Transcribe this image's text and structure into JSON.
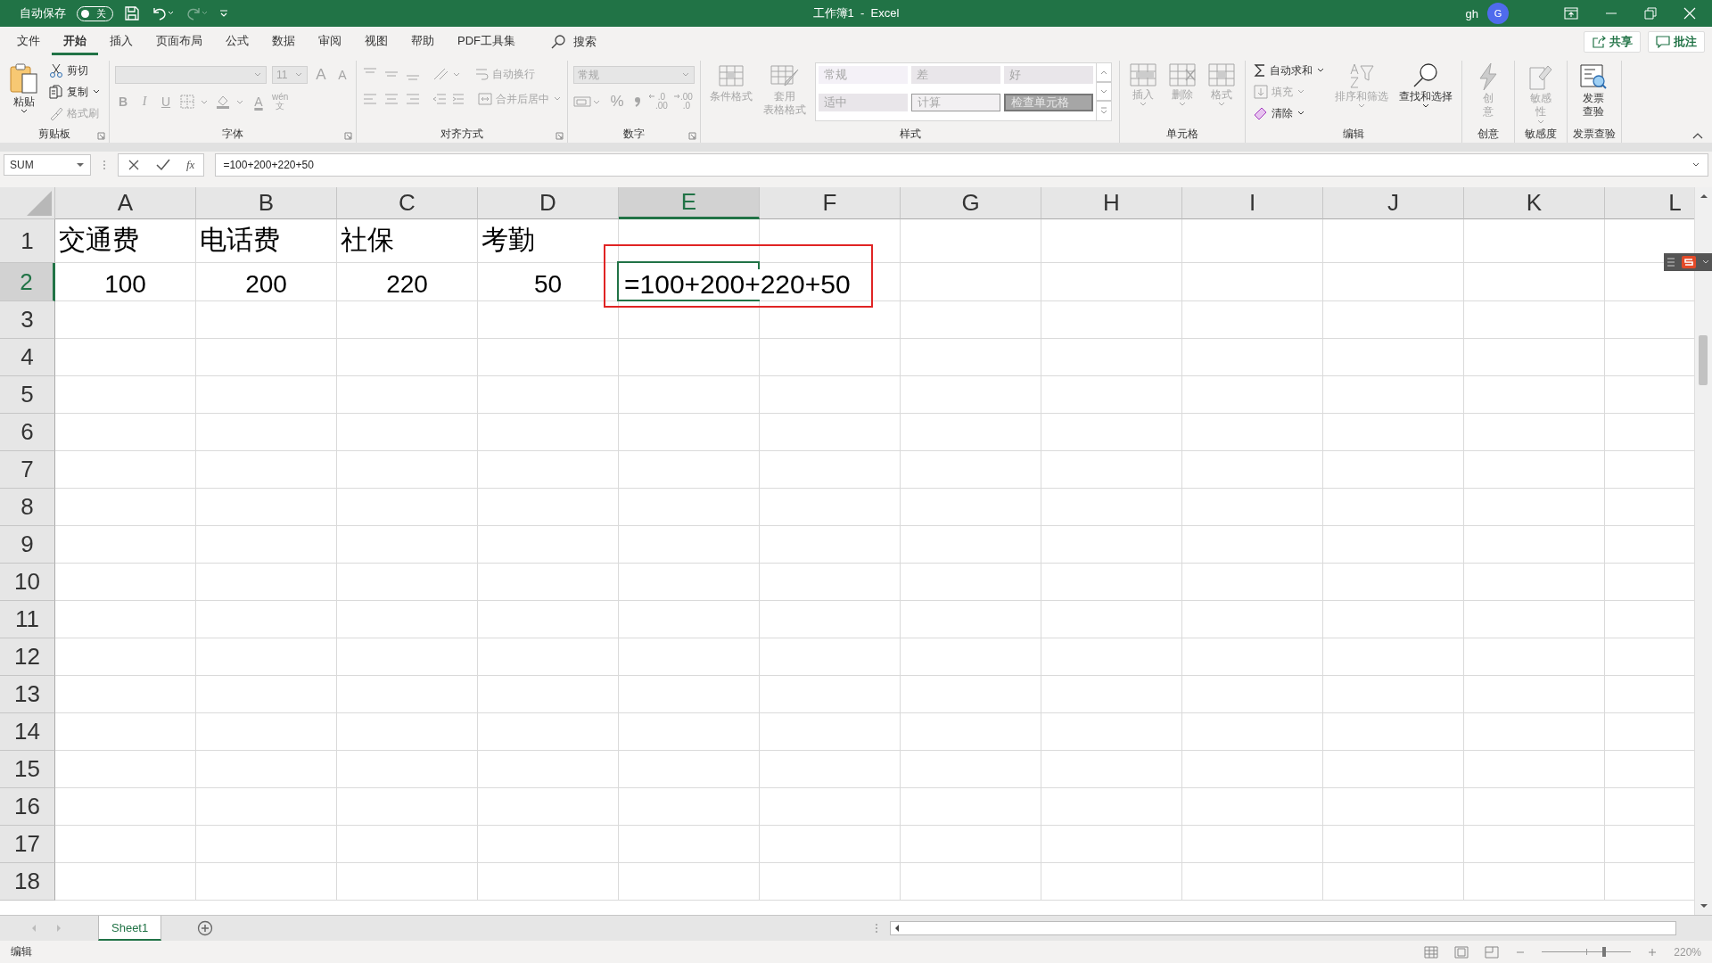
{
  "title_bar": {
    "autosave_label": "自动保存",
    "autosave": {
      "on": false,
      "label": "关"
    },
    "redo_disabled": true,
    "title": "工作簿1  -  Excel",
    "user": "gh",
    "avatar": "G"
  },
  "tabs": [
    {
      "label": "文件",
      "selected": false
    },
    {
      "label": "开始",
      "selected": true
    },
    {
      "label": "插入",
      "selected": false
    },
    {
      "label": "页面布局",
      "selected": false
    },
    {
      "label": "公式",
      "selected": false
    },
    {
      "label": "数据",
      "selected": false
    },
    {
      "label": "审阅",
      "selected": false
    },
    {
      "label": "视图",
      "selected": false
    },
    {
      "label": "帮助",
      "selected": false
    },
    {
      "label": "PDF工具集",
      "selected": false
    }
  ],
  "search": {
    "label": "搜索"
  },
  "actions": [
    {
      "kind": "share",
      "label": "共享"
    },
    {
      "kind": "comment",
      "label": "批注"
    }
  ],
  "ribbon": [
    {
      "kind": "clipboard",
      "label": "剪贴板",
      "paste": {
        "label": "粘贴",
        "disabled": false
      },
      "items": [
        {
          "kind": "cut",
          "label": "剪切",
          "disabled": false
        },
        {
          "kind": "copy",
          "label": "复制",
          "disabled": false
        },
        {
          "kind": "painter",
          "label": "格式刷",
          "disabled": true
        }
      ]
    },
    {
      "kind": "font",
      "label": "字体",
      "disabled": true,
      "size": "11",
      "grow": "A",
      "shrink": "A",
      "styles": [
        "B",
        "I",
        "U"
      ],
      "color_letter": "A",
      "phonetic_top": "wén",
      "phonetic_bottom": "文"
    },
    {
      "kind": "alignment",
      "label": "对齐方式",
      "disabled": true,
      "wrap": "自动换行",
      "merge": "合并后居中"
    },
    {
      "kind": "number",
      "label": "数字",
      "disabled": true,
      "format": "常规",
      "percent": "%",
      "decimals": [
        {
          "top": ".0",
          "bottom": ".00"
        },
        {
          "top": ".00",
          "bottom": ".0"
        }
      ]
    },
    {
      "kind": "styles",
      "label": "样式",
      "buttons": [
        {
          "kind": "conditional",
          "lines": [
            "条件格式"
          ],
          "disabled": true
        },
        {
          "kind": "table",
          "lines": [
            "套用",
            "表格格式"
          ],
          "disabled": true
        }
      ],
      "gallery": [
        {
          "kind": "normal",
          "label": "常规"
        },
        {
          "kind": "bad",
          "label": "差"
        },
        {
          "kind": "good",
          "label": "好"
        },
        {
          "kind": "neutral",
          "label": "适中"
        },
        {
          "kind": "calc",
          "label": "计算"
        },
        {
          "kind": "check",
          "label": "检查单元格"
        }
      ]
    },
    {
      "kind": "cells",
      "label": "单元格",
      "buttons": [
        {
          "kind": "insert",
          "label": "插入",
          "disabled": true
        },
        {
          "kind": "delete",
          "label": "删除",
          "disabled": true
        },
        {
          "kind": "format",
          "label": "格式",
          "disabled": true
        }
      ]
    },
    {
      "kind": "editing",
      "label": "编辑",
      "items": [
        {
          "kind": "sum",
          "label": "自动求和",
          "disabled": false
        },
        {
          "kind": "fill",
          "label": "填充",
          "disabled": true
        },
        {
          "kind": "clear",
          "label": "清除",
          "disabled": false
        }
      ],
      "buttons": [
        {
          "kind": "sort",
          "label": "排序和筛选",
          "disabled": true
        },
        {
          "kind": "find",
          "label": "查找和选择",
          "disabled": false
        }
      ]
    },
    {
      "kind": "single",
      "label": "创意",
      "button": {
        "kind": "bolt",
        "lines": [
          "创",
          "意"
        ],
        "disabled": true
      }
    },
    {
      "kind": "single",
      "label": "敏感度",
      "button": {
        "kind": "sensitivity",
        "lines": [
          "敏感",
          "性"
        ],
        "disabled": true
      }
    },
    {
      "kind": "single",
      "label": "发票查验",
      "button": {
        "kind": "invoice",
        "lines": [
          "发票",
          "查验"
        ],
        "disabled": false
      }
    }
  ],
  "formula_bar": {
    "name_box": "SUM",
    "fx": "fx",
    "formula": "=100+200+220+50"
  },
  "columns": [
    {
      "label": "A",
      "selected": false
    },
    {
      "label": "B",
      "selected": false
    },
    {
      "label": "C",
      "selected": false
    },
    {
      "label": "D",
      "selected": false
    },
    {
      "label": "E",
      "selected": true
    },
    {
      "label": "F",
      "selected": false
    },
    {
      "label": "G",
      "selected": false
    },
    {
      "label": "H",
      "selected": false
    },
    {
      "label": "I",
      "selected": false
    },
    {
      "label": "J",
      "selected": false
    },
    {
      "label": "K",
      "selected": false
    },
    {
      "label": "L",
      "selected": false
    }
  ],
  "rows": [
    {
      "label": "1",
      "selected": false,
      "cells": [
        {
          "kind": "text",
          "text": "交通费"
        },
        {
          "kind": "text",
          "text": "电话费"
        },
        {
          "kind": "text",
          "text": "社保"
        },
        {
          "kind": "text",
          "text": "考勤"
        }
      ]
    },
    {
      "label": "2",
      "selected": true,
      "cells": [
        {
          "kind": "number",
          "text": "100"
        },
        {
          "kind": "number",
          "text": "200"
        },
        {
          "kind": "number",
          "text": "220"
        },
        {
          "kind": "number",
          "text": "50"
        },
        {
          "kind": "editing",
          "text": "=100+200+220+50",
          "highlighted": true
        }
      ]
    },
    {
      "label": "3",
      "selected": false,
      "cells": []
    },
    {
      "label": "4",
      "selected": false,
      "cells": []
    },
    {
      "label": "5",
      "selected": false,
      "cells": []
    },
    {
      "label": "6",
      "selected": false,
      "cells": []
    },
    {
      "label": "7",
      "selected": false,
      "cells": []
    },
    {
      "label": "8",
      "selected": false,
      "cells": []
    },
    {
      "label": "9",
      "selected": false,
      "cells": []
    },
    {
      "label": "10",
      "selected": false,
      "cells": []
    },
    {
      "label": "11",
      "selected": false,
      "cells": []
    },
    {
      "label": "12",
      "selected": false,
      "cells": []
    },
    {
      "label": "13",
      "selected": false,
      "cells": []
    },
    {
      "label": "14",
      "selected": false,
      "cells": []
    },
    {
      "label": "15",
      "selected": false,
      "cells": []
    },
    {
      "label": "16",
      "selected": false,
      "cells": []
    },
    {
      "label": "17",
      "selected": false,
      "cells": []
    },
    {
      "label": "18",
      "selected": false,
      "cells": []
    }
  ],
  "sheets": [
    {
      "label": "Sheet1",
      "selected": true
    }
  ],
  "status_bar": {
    "mode": "编辑",
    "zoom": "220%",
    "level": 0.7
  }
}
